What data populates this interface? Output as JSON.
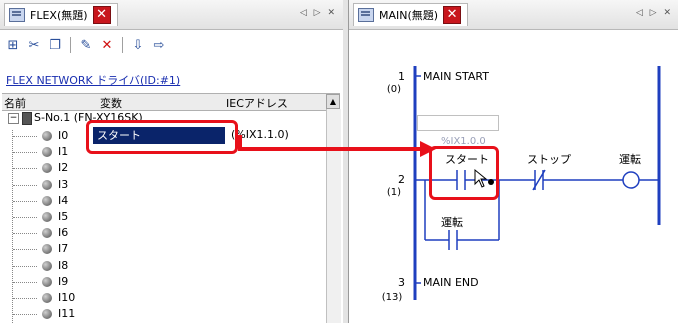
{
  "left_pane": {
    "tab_title": "FLEX(無題)",
    "tab_close": "✕",
    "tab_nav": "◁ ▷ ✕",
    "toolbar_icons": [
      "add-tag-icon",
      "cut-icon",
      "copy-icon",
      "edit-icon",
      "delete-icon",
      "import-icon",
      "export-icon"
    ],
    "network_link": "FLEX NETWORK ドライバ(ID:#1)",
    "columns": {
      "name": "名前",
      "variable": "変数",
      "iec": "IECアドレス"
    },
    "node": {
      "expander": "−",
      "label": "S-No.1 (FN-XY16SK)"
    },
    "io_rows": [
      "I0",
      "I1",
      "I2",
      "I3",
      "I4",
      "I5",
      "I6",
      "I7",
      "I8",
      "I9",
      "I10",
      "I11"
    ],
    "selected_variable": "スタート",
    "selected_address": "(%IX1.1.0)"
  },
  "right_pane": {
    "tab_title": "MAIN(無題)",
    "tab_close": "✕",
    "tab_nav": "◁ ▷ ✕",
    "rungs": [
      {
        "no": "1",
        "sub": "(0)",
        "label": "MAIN START"
      },
      {
        "no": "2",
        "sub": "(1)"
      },
      {
        "no": "3",
        "sub": "(13)",
        "label": "MAIN END"
      }
    ],
    "address_hint": "%IX1.0.0",
    "contact_start": "スタート",
    "contact_stop": "ストップ",
    "coil_run": "運転",
    "contact_run": "運転"
  },
  "colors": {
    "highlight": "#e8101a",
    "selection": "#0a246a",
    "ladder_blue": "#1f3fbf"
  }
}
